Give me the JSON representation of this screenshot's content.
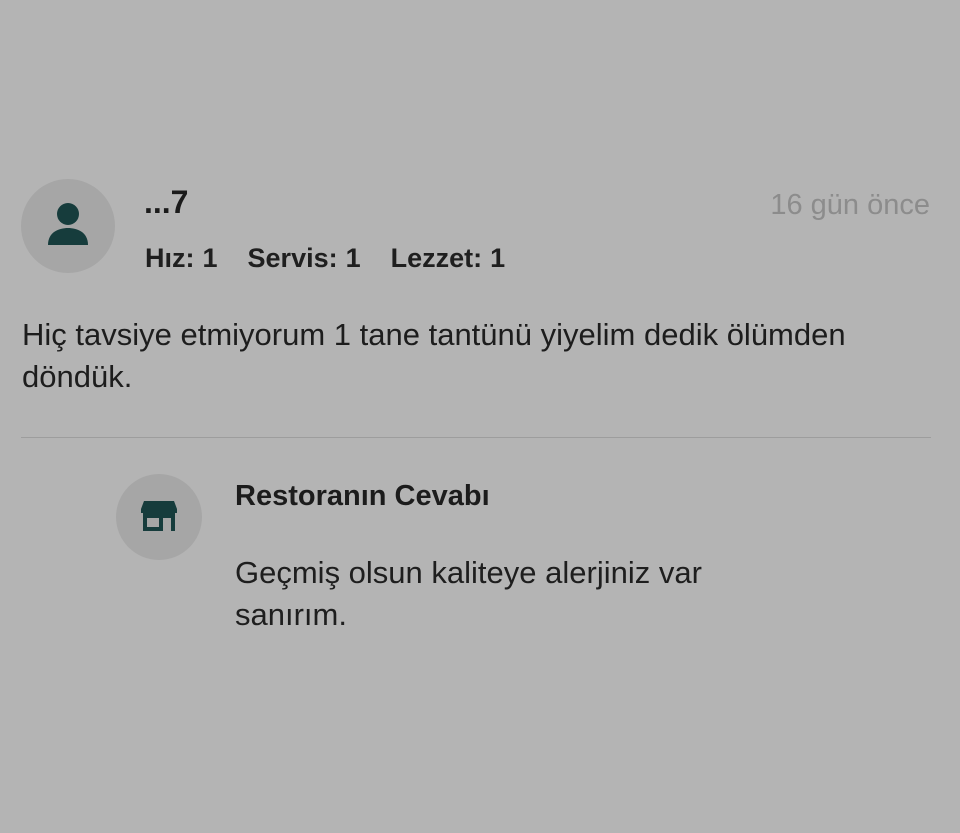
{
  "review": {
    "user": {
      "name": "...7",
      "avatar_icon": "user-icon"
    },
    "date": "16 gün önce",
    "ratings": [
      {
        "label": "Hız:",
        "value": "1"
      },
      {
        "label": "Servis:",
        "value": "1"
      },
      {
        "label": "Lezzet:",
        "value": "1"
      }
    ],
    "text": "Hiç tavsiye etmiyorum 1 tane tantünü yiyelim dedik ölümden döndük."
  },
  "reply": {
    "icon": "store-icon",
    "title": "Restoranın Cevabı",
    "text": "Geçmiş olsun kaliteye alerjiniz var sanırım."
  },
  "colors": {
    "background": "#b4b4b4",
    "avatar_bg": "#a6a6a6",
    "icon": "#163c3c",
    "date_text": "#8c8c8c",
    "divider": "#9d9d9d"
  }
}
